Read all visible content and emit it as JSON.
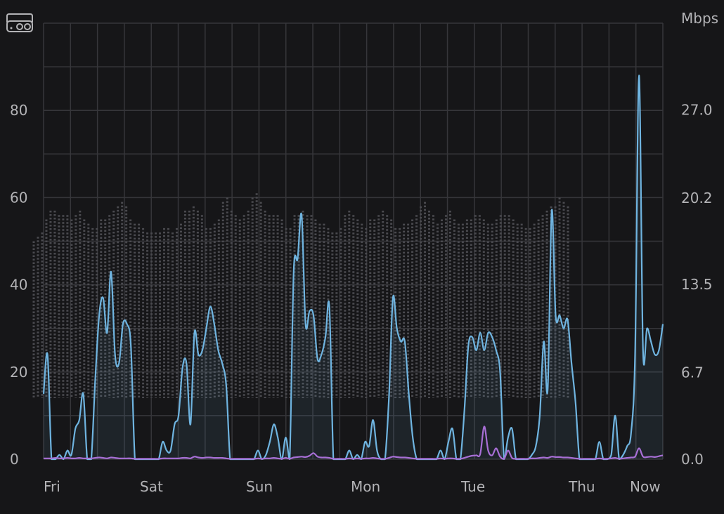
{
  "chart_data": {
    "type": "line",
    "title": "",
    "units_right": "Mbps",
    "icon": "router-icon",
    "grid": true,
    "colors": {
      "background": "#161618",
      "grid": "#36363a",
      "primary_line": "#6fb4e0",
      "secondary_line": "#a86fd6",
      "band_dots": "#4a4a4f",
      "area_fill": "#6fb4e0"
    },
    "x_ticks": [
      "Fri",
      "Sat",
      "Sun",
      "Mon",
      "Tue",
      "Thu",
      "Now"
    ],
    "left_axis": {
      "ticks": [
        "0",
        "20",
        "40",
        "60",
        "80"
      ],
      "values": [
        0,
        20,
        40,
        60,
        80
      ],
      "range": [
        0,
        100
      ]
    },
    "right_axis": {
      "ticks": [
        "0.0",
        "6.7",
        "13.5",
        "20.2",
        "27.0"
      ],
      "values": [
        0.0,
        6.7,
        13.5,
        20.2,
        27.0
      ],
      "range": [
        0,
        33.7
      ]
    },
    "series": [
      {
        "role": "primary",
        "values": [
          15,
          24,
          0,
          0,
          1,
          0,
          2,
          1,
          7,
          9,
          15,
          0,
          0,
          18,
          33,
          37,
          29,
          43,
          24,
          22,
          31,
          31,
          26,
          0,
          0,
          0,
          0,
          0,
          0,
          0,
          4,
          2,
          2,
          8,
          10,
          21,
          22,
          8,
          29,
          24,
          25,
          30,
          35,
          31,
          25,
          22,
          17,
          0,
          0,
          0,
          0,
          0,
          0,
          0,
          2,
          0,
          1,
          4,
          8,
          5,
          0,
          5,
          0,
          43,
          46,
          56,
          31,
          34,
          33,
          23,
          24,
          28,
          35,
          0,
          0,
          0,
          0,
          2,
          0,
          1,
          0,
          4,
          3,
          9,
          2,
          0,
          0,
          14,
          37,
          30,
          27,
          27,
          15,
          5,
          0,
          0,
          0,
          0,
          0,
          0,
          2,
          0,
          4,
          7,
          0,
          0,
          11,
          26,
          28,
          25,
          29,
          25,
          29,
          28,
          25,
          20,
          0,
          5,
          7,
          0,
          0,
          0,
          0,
          1,
          3,
          10,
          27,
          16,
          57,
          33,
          33,
          30,
          32,
          22,
          13,
          0,
          0,
          0,
          0,
          0,
          4,
          0,
          0,
          1,
          10,
          0,
          1,
          3,
          6,
          24,
          88,
          25,
          30,
          27,
          24,
          25,
          31
        ]
      },
      {
        "role": "secondary",
        "values": [
          0.2,
          0.2,
          0.2,
          0.3,
          0.2,
          0.2,
          0.3,
          0.2,
          0.2,
          0.3,
          0.2,
          0.2,
          0.2,
          0.3,
          0.4,
          0.3,
          0.2,
          0.4,
          0.3,
          0.2,
          0.2,
          0.2,
          0.2,
          0.1,
          0.1,
          0.1,
          0.1,
          0.1,
          0.1,
          0.1,
          0.2,
          0.2,
          0.2,
          0.2,
          0.2,
          0.3,
          0.3,
          0.2,
          0.6,
          0.4,
          0.3,
          0.4,
          0.4,
          0.3,
          0.3,
          0.3,
          0.2,
          0.1,
          0.1,
          0.1,
          0.1,
          0.1,
          0.1,
          0.1,
          0.2,
          0.1,
          0.2,
          0.2,
          0.3,
          0.2,
          0.1,
          0.3,
          0.1,
          0.4,
          0.5,
          0.6,
          0.5,
          0.8,
          1.4,
          0.6,
          0.4,
          0.4,
          0.3,
          0.1,
          0.1,
          0.1,
          0.1,
          0.2,
          0.1,
          0.2,
          0.1,
          0.2,
          0.2,
          0.3,
          0.2,
          0.1,
          0.1,
          0.3,
          0.6,
          0.5,
          0.4,
          0.4,
          0.3,
          0.2,
          0.1,
          0.1,
          0.1,
          0.1,
          0.1,
          0.1,
          0.2,
          0.1,
          0.2,
          0.2,
          0.1,
          0.1,
          0.3,
          0.6,
          0.8,
          0.9,
          1.2,
          7.5,
          2.0,
          0.9,
          2.5,
          0.6,
          0.1,
          2.0,
          0.3,
          0.1,
          0.1,
          0.1,
          0.1,
          0.2,
          0.2,
          0.3,
          0.4,
          0.3,
          0.6,
          0.5,
          0.5,
          0.4,
          0.4,
          0.3,
          0.2,
          0.1,
          0.1,
          0.1,
          0.1,
          0.1,
          0.2,
          0.1,
          0.1,
          0.2,
          0.3,
          0.1,
          0.2,
          0.3,
          0.4,
          0.6,
          2.5,
          0.6,
          0.5,
          0.6,
          0.5,
          0.7,
          0.9
        ]
      },
      {
        "role": "band",
        "low": 14,
        "high": [
          50,
          51,
          52,
          55,
          57,
          57,
          56,
          56,
          56,
          55,
          56,
          57,
          55,
          54,
          53,
          53,
          55,
          55,
          56,
          57,
          58,
          59,
          58,
          55,
          54,
          54,
          53,
          52,
          52,
          52,
          52,
          53,
          53,
          52,
          53,
          54,
          57,
          57,
          58,
          57,
          56,
          53,
          53,
          54,
          55,
          59,
          60,
          57,
          56,
          55,
          56,
          57,
          60,
          61,
          59,
          57,
          56,
          56,
          56,
          55,
          53,
          53,
          56,
          56,
          57,
          56,
          56,
          55,
          54,
          54,
          53,
          52,
          52,
          53,
          56,
          57,
          56,
          55,
          54,
          53,
          55,
          55,
          56,
          57,
          56,
          55,
          53,
          53,
          54,
          54,
          55,
          56,
          58,
          59,
          57,
          56,
          54,
          55,
          56,
          57,
          55,
          54,
          54,
          55,
          55,
          56,
          56,
          55,
          54,
          54,
          55,
          56,
          56,
          56,
          55,
          54,
          54,
          53,
          53,
          54,
          55,
          56,
          57,
          58,
          58,
          60,
          59,
          58
        ]
      }
    ]
  }
}
